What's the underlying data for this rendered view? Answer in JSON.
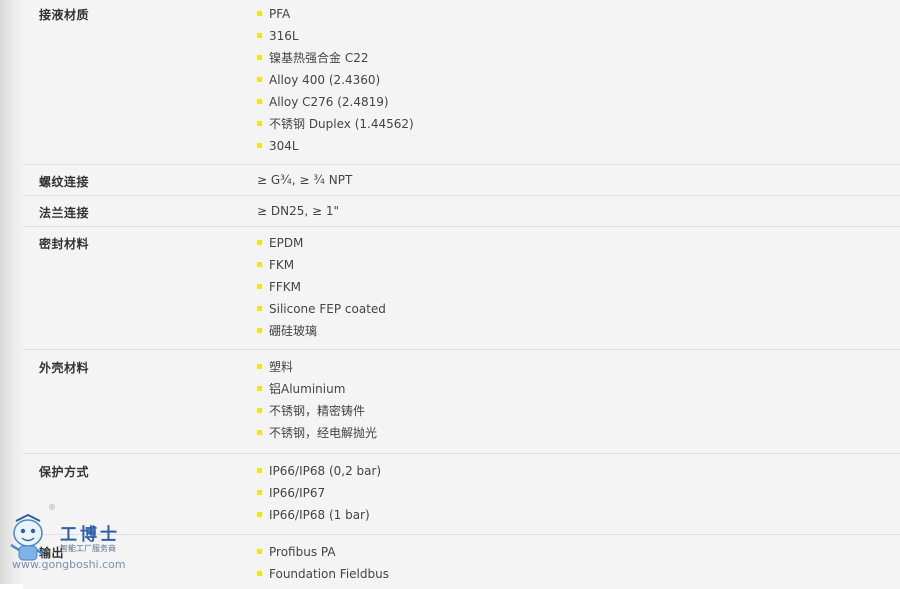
{
  "rows": [
    {
      "label": "接液材质",
      "values": [
        "PFA",
        "316L",
        "镍基热强合金 C22",
        "Alloy 400 (2.4360)",
        "Alloy C276 (2.4819)",
        "不锈钢 Duplex (1.44562)",
        "304L"
      ]
    },
    {
      "label": "螺纹连接",
      "values": [
        "≥ G¾, ≥ ¾ NPT"
      ]
    },
    {
      "label": "法兰连接",
      "values": [
        "≥ DN25, ≥ 1\""
      ]
    },
    {
      "label": "密封材料",
      "values": [
        "EPDM",
        "FKM",
        "FFKM",
        "Silicone FEP coated",
        "硼硅玻璃"
      ]
    },
    {
      "label": "外壳材料",
      "values": [
        "塑料",
        "铝Aluminium",
        "不锈钢，精密铸件",
        "不锈钢，经电解抛光"
      ]
    },
    {
      "label": "保护方式",
      "values": [
        "IP66/IP68 (0,2 bar)",
        "IP66/IP67",
        "IP66/IP68 (1 bar)"
      ]
    },
    {
      "label": "输出",
      "values": [
        "Profibus PA",
        "Foundation Fieldbus"
      ]
    }
  ],
  "watermark": {
    "title": "工博士",
    "subtitle": "智能工厂服务商",
    "domain": "www.gongboshi.com",
    "registered": "®"
  },
  "colors": {
    "bullet": "#f5e21a",
    "row_bg": "#f4f4f4",
    "divider": "#e0e0e0"
  }
}
